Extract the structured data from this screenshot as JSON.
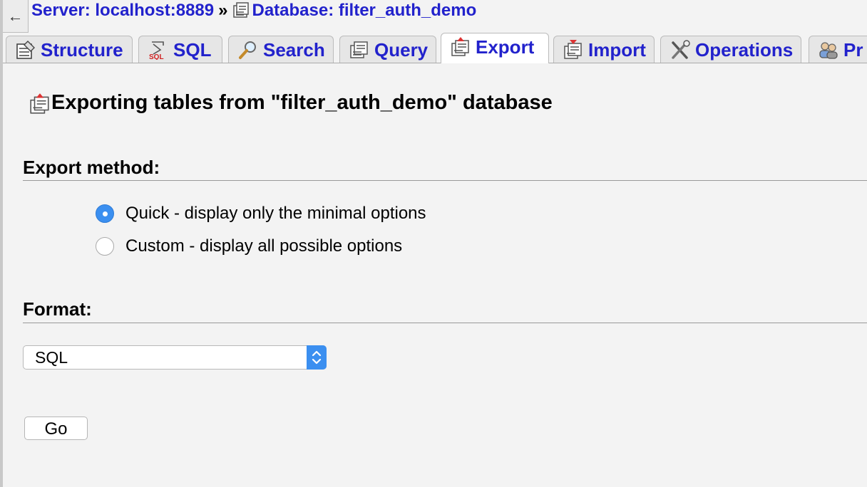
{
  "breadcrumb": {
    "server_label": "Server: localhost:8889",
    "separator": "»",
    "database_label": "Database: filter_auth_demo"
  },
  "tabs": [
    {
      "label": "Structure",
      "icon": "structure-icon",
      "active": false
    },
    {
      "label": "SQL",
      "icon": "sql-icon",
      "active": false
    },
    {
      "label": "Search",
      "icon": "search-icon",
      "active": false
    },
    {
      "label": "Query",
      "icon": "query-icon",
      "active": false
    },
    {
      "label": "Export",
      "icon": "export-icon",
      "active": true
    },
    {
      "label": "Import",
      "icon": "import-icon",
      "active": false
    },
    {
      "label": "Operations",
      "icon": "operations-icon",
      "active": false
    },
    {
      "label": "Pr",
      "icon": "privileges-icon",
      "active": false
    }
  ],
  "page": {
    "title": "Exporting tables from \"filter_auth_demo\" database"
  },
  "export_method": {
    "heading": "Export method:",
    "options": [
      {
        "label": "Quick - display only the minimal options",
        "checked": true
      },
      {
        "label": "Custom - display all possible options",
        "checked": false
      }
    ]
  },
  "format": {
    "heading": "Format:",
    "selected": "SQL"
  },
  "go_label": "Go",
  "collapse_glyph": "←",
  "colors": {
    "link": "#2222cc",
    "accent": "#3b8ff0",
    "background": "#f3f3f3"
  }
}
